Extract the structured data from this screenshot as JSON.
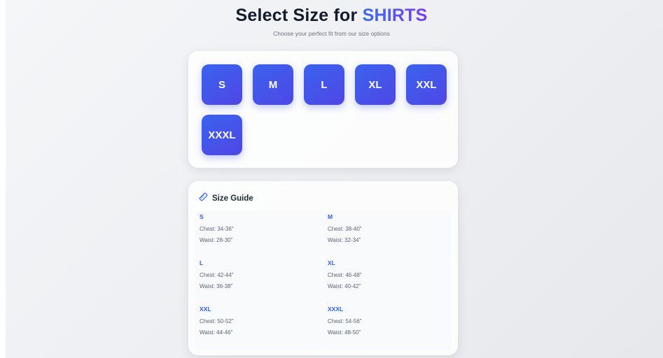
{
  "header": {
    "title_prefix": "Select Size for",
    "title_accent": "SHIRTS",
    "subtitle": "Choose your perfect fit from our size options"
  },
  "sizes": [
    "S",
    "M",
    "L",
    "XL",
    "XXL",
    "XXXL"
  ],
  "guide": {
    "title": "Size Guide",
    "icon": "ruler-icon",
    "items": [
      {
        "size": "S",
        "chest": "Chest: 34-36\"",
        "waist": "Waist: 28-30\""
      },
      {
        "size": "M",
        "chest": "Chest: 38-40\"",
        "waist": "Waist: 32-34\""
      },
      {
        "size": "L",
        "chest": "Chest: 42-44\"",
        "waist": "Waist: 36-38\""
      },
      {
        "size": "XL",
        "chest": "Chest: 46-48\"",
        "waist": "Waist: 40-42\""
      },
      {
        "size": "XXL",
        "chest": "Chest: 50-52\"",
        "waist": "Waist: 44-46\""
      },
      {
        "size": "XXXL",
        "chest": "Chest: 54-56\"",
        "waist": "Waist: 48-50\""
      }
    ]
  },
  "colors": {
    "accent": "#3b6bf0",
    "accent_end": "#7a3cf0",
    "button": "#4356e9",
    "guide_size": "#2f5fe0"
  }
}
